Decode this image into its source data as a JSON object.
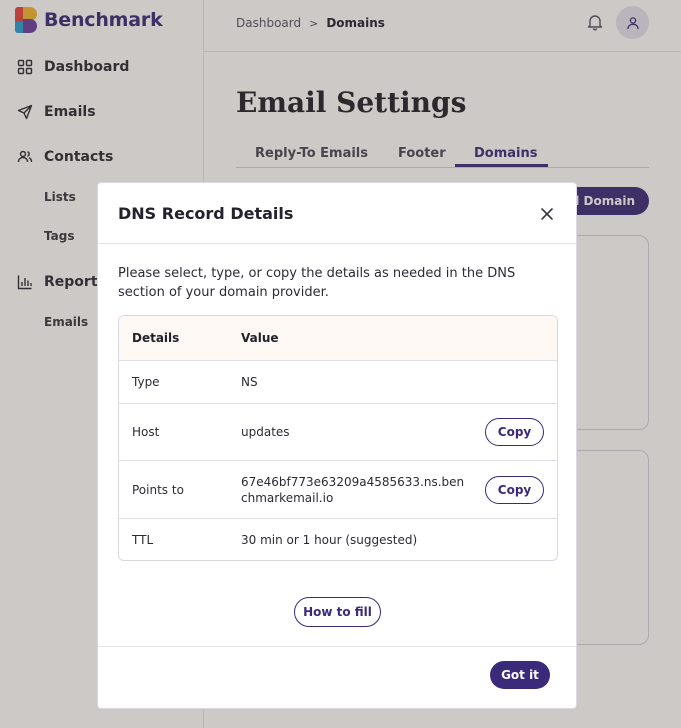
{
  "app": {
    "logo_text": "Benchmark"
  },
  "sidebar": {
    "items": [
      {
        "label": "Dashboard",
        "icon": "grid-icon"
      },
      {
        "label": "Emails",
        "icon": "send-icon"
      },
      {
        "label": "Contacts",
        "icon": "users-icon"
      },
      {
        "label": "Lists"
      },
      {
        "label": "Tags"
      },
      {
        "label": "Reports",
        "icon": "bar-chart-icon"
      },
      {
        "label": "Emails"
      }
    ]
  },
  "header": {
    "breadcrumb": [
      "Dashboard",
      "Domains"
    ],
    "breadcrumb_separator": ">",
    "bell_icon": "bell-icon",
    "avatar_icon": "user-icon"
  },
  "page": {
    "title": "Email Settings",
    "tabs": [
      {
        "label": "Reply-To Emails",
        "active": false
      },
      {
        "label": "Footer",
        "active": false
      },
      {
        "label": "Domains",
        "active": true
      }
    ],
    "add_domain_label": "d Domain"
  },
  "modal": {
    "title": "DNS Record Details",
    "description": "Please select, type, or copy the details as needed in the DNS section of your domain provider.",
    "table": {
      "columns": [
        "Details",
        "Value"
      ],
      "rows": [
        {
          "key": "Type",
          "value": "NS",
          "copy": false
        },
        {
          "key": "Host",
          "value": "updates",
          "copy": true
        },
        {
          "key": "Points to",
          "value": "67e46bf773e63209a4585633.ns.benchmarkemail.io",
          "copy": true
        },
        {
          "key": "TTL",
          "value": "30 min or 1 hour (suggested)",
          "copy": false
        }
      ]
    },
    "copy_label": "Copy",
    "how_to_fill_label": "How to fill",
    "got_it_label": "Got it"
  },
  "colors": {
    "brand": "#3b2a7a",
    "overlay": "rgba(72,60,52,0.28)",
    "table_header_bg": "#fdf8f3"
  }
}
